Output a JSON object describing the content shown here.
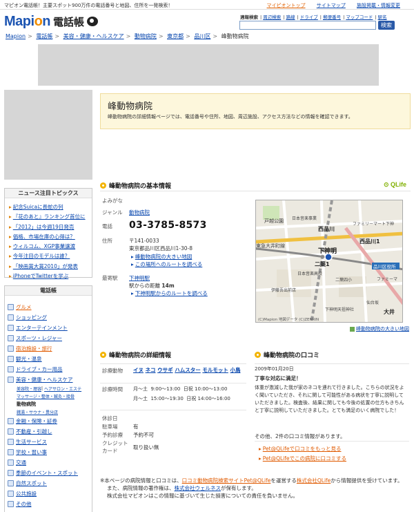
{
  "topbar": {
    "tagline": "マピオン電話帳！主要スポット900万件の電話番号と地図、住所を一発検索！",
    "links": [
      {
        "label": "マイピオントップ",
        "highlight": true
      },
      {
        "label": "サイトマップ",
        "highlight": false
      },
      {
        "label": "施設掲載・情報変更",
        "highlight": false
      }
    ]
  },
  "logo": {
    "brand_a": "Mapi",
    "brand_o": "o",
    "brand_b": "n",
    "sub": "電話帳"
  },
  "search": {
    "label": "週報検索",
    "tabs": [
      "周辺検索",
      "路線",
      "ドライブ",
      "郵便番号",
      "マップコード",
      "駅名"
    ],
    "placeholder": "",
    "button": "検索"
  },
  "breadcrumb": [
    "Mapion",
    "電話帳",
    "美容・健康・ヘルスケア",
    "動物病院",
    "東京都",
    "品川区",
    "峰動物病院"
  ],
  "title_box": {
    "name": "峰動物病院",
    "description": "峰動物病院の詳細情報ページでは、電話番号や住所、地図、周辺施設、アクセス方法などの情報を確認できます。"
  },
  "news": {
    "title": "ニュース注目トピックス",
    "items": [
      "記念Suicaに長蛇の列",
      "『花のあと』ランキング首位に",
      "「2012」は今週19日発売",
      "価格、市場在庫の心得は？",
      "ウィルコム、XGP事業譲渡",
      "今年注目のモデルは誰？",
      "「映画賞大賞2010」が発表",
      "iPhoneでTwitterを学ぶ"
    ]
  },
  "categories": {
    "title": "電話帳",
    "items": [
      {
        "label": "グルメ",
        "style": "orange"
      },
      {
        "label": "ショッピング",
        "style": "normal"
      },
      {
        "label": "エンターテインメント",
        "style": "normal"
      },
      {
        "label": "スポーツ・レジャー",
        "style": "normal"
      },
      {
        "label": "宿泊施設・旅行",
        "style": "orange"
      },
      {
        "label": "観光・温泉",
        "style": "normal"
      },
      {
        "label": "ドライブ・カー用品",
        "style": "normal"
      },
      {
        "label": "美容・健康・ヘルスケア",
        "style": "normal"
      }
    ],
    "sub_links_1": [
      "美容院・理容",
      "ヘアサロン・エステ",
      "マッサージ・整体・鍼灸・接骨"
    ],
    "current_sub": "動物病院",
    "sub_links_2": [
      "銭湯・サウナ・異分店"
    ],
    "items2": [
      {
        "label": "金融・保険・証券",
        "style": "normal"
      },
      {
        "label": "不動産・引越し",
        "style": "normal"
      },
      {
        "label": "生活サービス",
        "style": "normal"
      },
      {
        "label": "学校・習い事",
        "style": "normal"
      },
      {
        "label": "交通",
        "style": "normal"
      },
      {
        "label": "季節のイベント・スポット",
        "style": "normal"
      },
      {
        "label": "自然スポット",
        "style": "normal"
      },
      {
        "label": "公共施設",
        "style": "normal"
      },
      {
        "label": "その他",
        "style": "normal"
      }
    ]
  },
  "basic": {
    "heading": "峰動物病院の基本情報",
    "partner": "QLife",
    "reading_label": "よみがな",
    "genre_label": "ジャンル",
    "genre_value": "動物病院",
    "phone_label": "電話",
    "phone": "03-3785-8573",
    "address_label": "住所",
    "postal": "〒141-0033",
    "address": "東京都品川区西品川1-30-8",
    "map_link": "峰動物病院の大きい地図",
    "route_link": "この場所へのルートを調べる",
    "station_label": "最寄駅",
    "station": "下神明駅",
    "distance_prefix": "駅からの距離",
    "distance_value": "14",
    "distance_unit": "m",
    "station_route_link": "下神明駅からのルートを調べる"
  },
  "map": {
    "caption": "峰動物病院の大きい地図",
    "copyright": "(C)Mapion 地図データ (C)ZENRIN",
    "labels": {
      "park": "戸越公園",
      "shinagawa": "西品川",
      "nishishina1": "西品川1",
      "station": "下神明",
      "oimachi": "東急大井町線",
      "higashi": "品川区役所",
      "hall": "日本音楽事業",
      "family": "ファミリーマート下神",
      "futaba": "二葉1",
      "futabasho": "二葉四小",
      "shrine": "伊藤吾出前店",
      "kita": "日本音楽高校",
      "yutenji": "仙台坂",
      "kanra": "大井",
      "mart": "ファミーマ",
      "shimo": "下神明天祖神社"
    }
  },
  "detail": {
    "heading": "峰動物病院の詳細情報",
    "animals_label": "診療動物",
    "animals": [
      "イヌ",
      "ネコ",
      "ウサギ",
      "ハムスター",
      "モルモット",
      "小鳥"
    ],
    "hours_label": "診療時間",
    "hours": [
      {
        "days": "月〜土",
        "am": "9:00〜13:00",
        "day_label": "日祝",
        "day_time": "10:00〜13:00"
      },
      {
        "days": "月〜土",
        "am": "15:00〜19:30",
        "day_label": "日祝",
        "day_time": "14:00〜16:00"
      }
    ],
    "closed_label": "休診日",
    "closed_value": "",
    "parking_label": "駐車場",
    "parking_value": "有",
    "reservation_label": "予約診療",
    "reservation_value": "予約不可",
    "card_label": "クレジットカード",
    "card_value": "取り扱い無"
  },
  "reviews": {
    "heading": "峰動物病院の口コミ",
    "date": "2009年01月20日",
    "review_title": "丁寧な対応に満足！",
    "review_text": "体重が激減した我が家のネコを連れて行きました。こちらの状況をよく聞いていただき、それに関して可能性がある病状を丁寧に説明していただきました。検査後、結果に関しても今後の処置の仕方もきちんと丁寧に説明していただきました。とても満足のいく病院でした！",
    "count_text": "その他、2件の口コミ情報があります。",
    "more_link": "Pet@QLifeで口コミをもっと見る",
    "post_link": "Pet@QLifeでこの病院に口コミする"
  },
  "footnote": {
    "line1_a": "※本ページの病院情報と口コミは、",
    "line1_link": "口コミ動物病院検索サイトPet@QLife",
    "line1_b": "を運営する",
    "line1_link2": "株式会社QLife",
    "line1_c": "から情報提供を受けています。",
    "line2_a": "また、病院情報の著作権は、",
    "line2_link": "株式会社ウェルネス",
    "line2_b": "が保有します。",
    "line3": "株式会社マピオンはこの情報に基づいて生じた損害についての責任を負いません。"
  }
}
